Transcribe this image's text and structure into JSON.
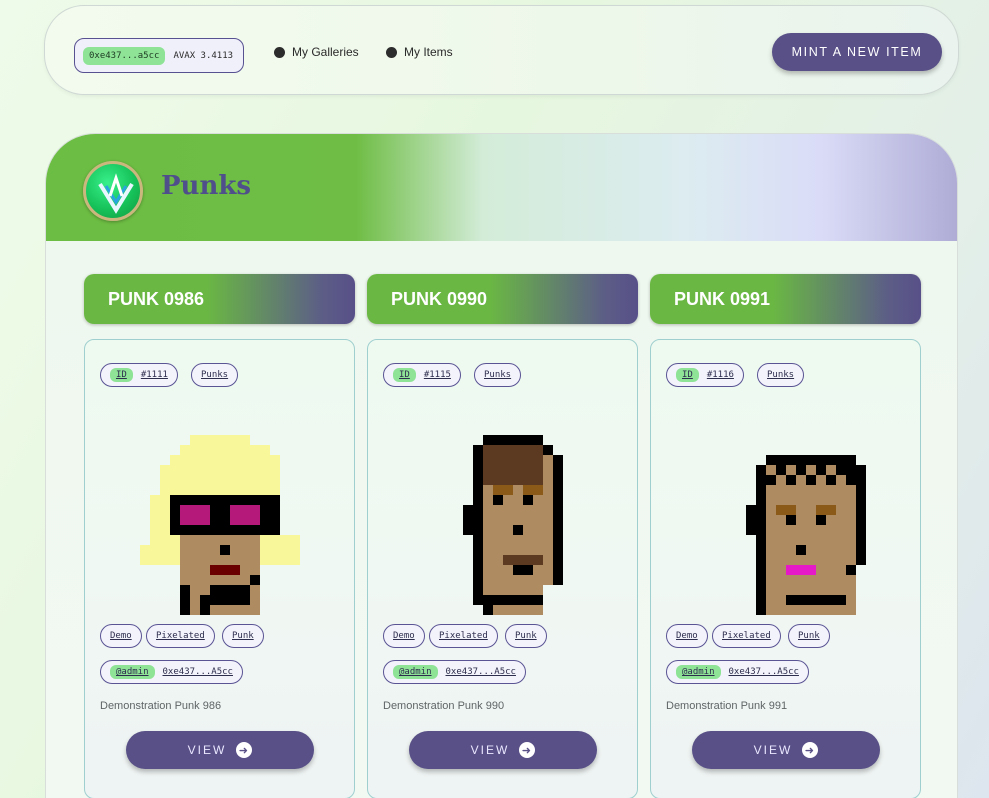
{
  "wallet": {
    "address": "0xe437...a5cc",
    "balance": "AVAX 3.4113"
  },
  "nav": {
    "galleries": "My Galleries",
    "items": "My Items"
  },
  "mint_label": "MINT A NEW ITEM",
  "gallery": {
    "title": "Punks",
    "logo": "logo-icon"
  },
  "cards": [
    {
      "name": "PUNK 0986",
      "id_label": "ID",
      "id": "#1111",
      "collection": "Punks",
      "tags": [
        "Demo",
        "Pixelated",
        "Punk"
      ],
      "owner_role": "@admin",
      "owner": "0xe437...A5cc",
      "description": "Demonstration Punk 986",
      "view": "VIEW"
    },
    {
      "name": "PUNK 0990",
      "id_label": "ID",
      "id": "#1115",
      "collection": "Punks",
      "tags": [
        "Demo",
        "Pixelated",
        "Punk"
      ],
      "owner_role": "@admin",
      "owner": "0xe437...A5cc",
      "description": "Demonstration Punk 990",
      "view": "VIEW"
    },
    {
      "name": "PUNK 0991",
      "id_label": "ID",
      "id": "#1116",
      "collection": "Punks",
      "tags": [
        "Demo",
        "Pixelated",
        "Punk"
      ],
      "owner_role": "@admin",
      "owner": "0xe437...A5cc",
      "description": "Demonstration Punk 991",
      "view": "VIEW"
    }
  ],
  "colors": {
    "accent": "#585087",
    "green": "#6ab843",
    "pill_green": "#8fe397"
  }
}
